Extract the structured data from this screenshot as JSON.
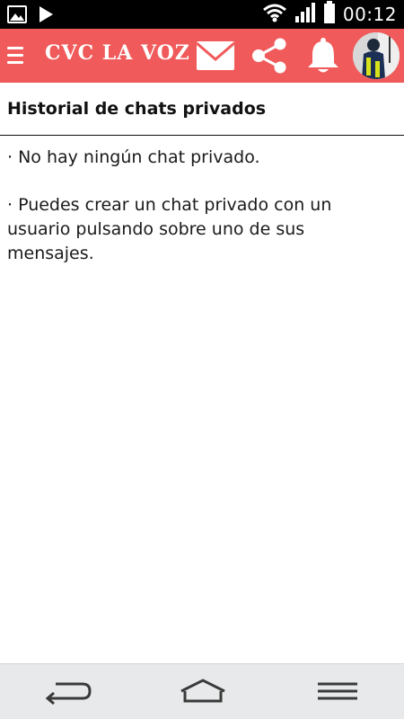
{
  "status_bar": {
    "left_icons": [
      "image-notification-icon",
      "play-notification-icon"
    ],
    "right_icons": [
      "wifi-icon",
      "signal-icon",
      "battery-icon"
    ],
    "time": "00:12"
  },
  "app_bar": {
    "title": "CVC LA VOZ",
    "background_color": "#f05a5a",
    "icons": [
      "menu-icon",
      "mail-icon",
      "share-icon",
      "bell-icon"
    ]
  },
  "main": {
    "section_title": "Historial de chats privados",
    "messages": [
      "· No hay ningún chat privado.",
      "· Puedes crear un chat privado con un usuario pulsando sobre uno de sus mensajes."
    ]
  },
  "nav_bar": {
    "icons": [
      "back-icon",
      "home-icon",
      "recent-apps-icon"
    ]
  }
}
